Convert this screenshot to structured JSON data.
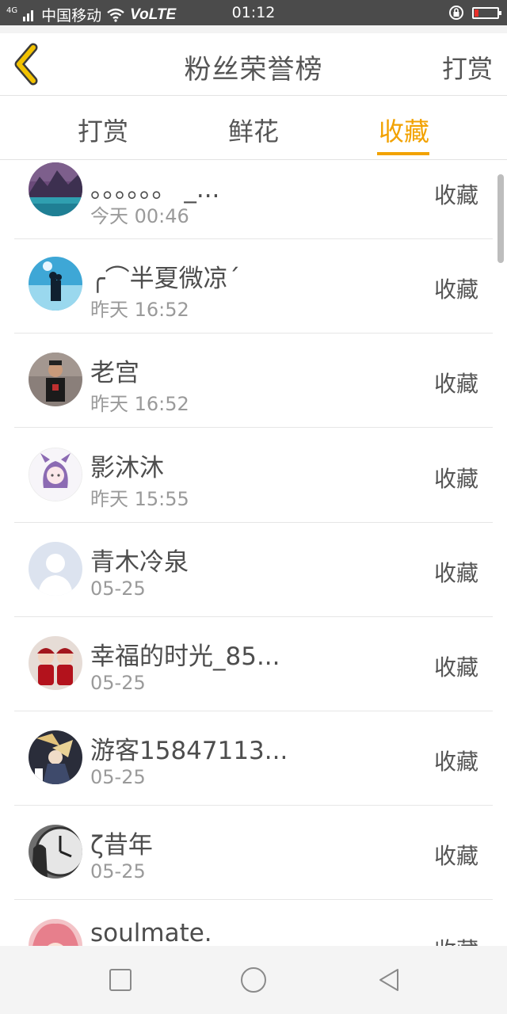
{
  "status_bar": {
    "network": "4G",
    "carrier": "中国移动",
    "volte": "VoLTE",
    "time": "01:12"
  },
  "header": {
    "title": "粉丝荣誉榜",
    "action_label": "打赏"
  },
  "tabs": [
    {
      "label": "打赏",
      "active": false
    },
    {
      "label": "鲜花",
      "active": false
    },
    {
      "label": "收藏",
      "active": true
    }
  ],
  "fans": [
    {
      "name": "。。。。。。 _...",
      "time": "今天 00:46",
      "action": "收藏",
      "avatar": "mountain-lake-photo"
    },
    {
      "name": "╭⌒半夏微凉΄",
      "time": "昨天 16:52",
      "action": "收藏",
      "avatar": "couple-silhouette-photo"
    },
    {
      "name": "老宫",
      "time": "昨天 16:52",
      "action": "收藏",
      "avatar": "man-portrait-photo"
    },
    {
      "name": "影沐沐",
      "time": "昨天 15:55",
      "action": "收藏",
      "avatar": "anime-girl-drawing"
    },
    {
      "name": "青木冷泉",
      "time": "05-25",
      "action": "收藏",
      "avatar": "default-user-avatar"
    },
    {
      "name": "幸福的时光_85...",
      "time": "05-25",
      "action": "收藏",
      "avatar": "red-dolls-photo"
    },
    {
      "name": "游客15847113...",
      "time": "05-25",
      "action": "收藏",
      "avatar": "anime-character-photo"
    },
    {
      "name": "ζ昔年",
      "time": "05-25",
      "action": "收藏",
      "avatar": "clock-photo"
    },
    {
      "name": "soulmate.",
      "time": "",
      "action": "收藏",
      "avatar": "pink-hair-anime"
    }
  ],
  "colors": {
    "accent": "#f2a200",
    "text": "#555555",
    "secondary_text": "#9a9a9a",
    "status_bar": "#4b4b4b"
  }
}
